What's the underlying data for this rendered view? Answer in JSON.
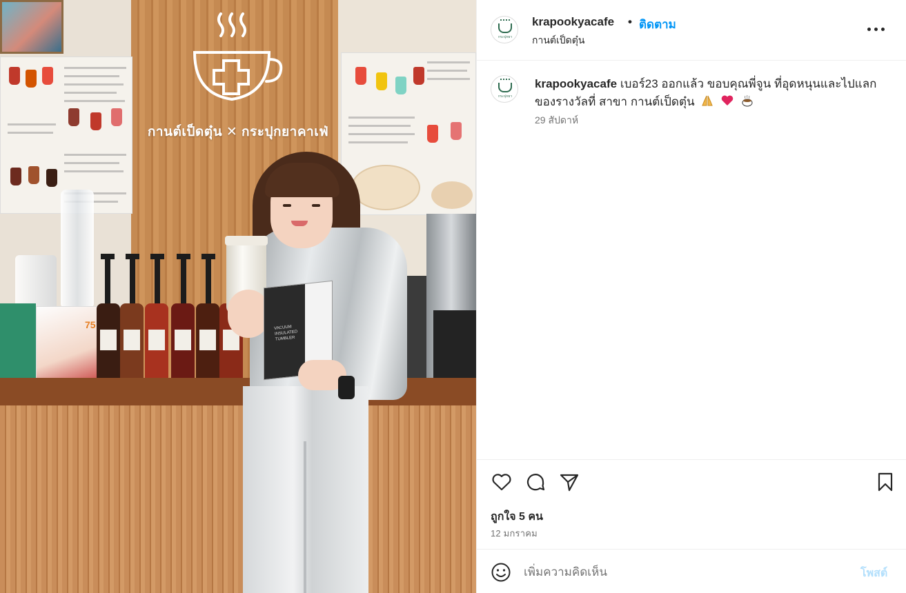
{
  "photo": {
    "sign_text": "กานต์เป็ดตุ๋น ✕ กระปุกยาคาเฟ่",
    "box_text": "VACUUM INSULATED TUMBLER",
    "promo_price": "75"
  },
  "header": {
    "username": "krapookyacafe",
    "separator": "•",
    "follow_label": "ติดตาม",
    "location": "กานต์เป็ดตุ๋น",
    "avatar_text": "กระปุกยา"
  },
  "caption": {
    "username": "krapookyacafe",
    "text": "เบอร์23 ออกแล้ว ขอบคุณพี่จูน ที่อุดหนุนและไปแลกของรางวัลที่ สาขา กานต์เป็ดตุ๋น",
    "emojis": [
      "folded-hands-icon",
      "red-heart-icon",
      "hot-beverage-icon"
    ],
    "time": "29 สัปดาห์"
  },
  "actions": {
    "icons": [
      "heart-icon",
      "comment-icon",
      "share-icon",
      "bookmark-icon"
    ],
    "likes": "ถูกใจ 5 คน",
    "date": "12 มกราคม"
  },
  "comment": {
    "placeholder": "เพิ่มความคิดเห็น",
    "post_label": "โพสต์"
  },
  "colors": {
    "accent": "#0095f6",
    "post_disabled": "#b2dffc",
    "text": "#262626",
    "secondary": "#737373"
  }
}
